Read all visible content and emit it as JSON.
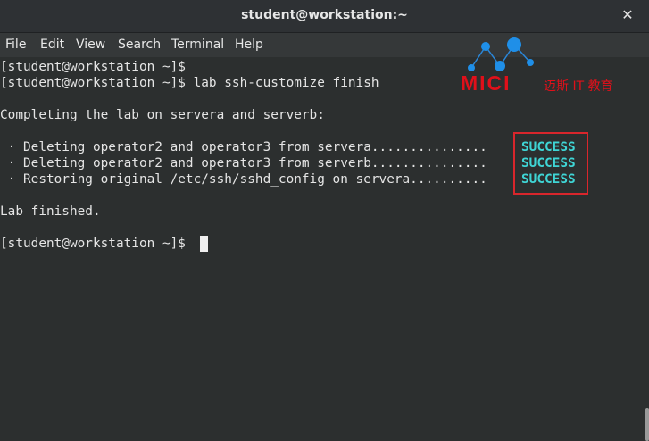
{
  "window": {
    "title": "student@workstation:~"
  },
  "menu": [
    "File",
    "Edit",
    "View",
    "Search",
    "Terminal",
    "Help"
  ],
  "terminal": {
    "lines": [
      "[student@workstation ~]$",
      "[student@workstation ~]$ lab ssh-customize finish",
      "",
      "Completing the lab on servera and serverb:",
      "",
      " · Deleting operator2 and operator3 from servera...............",
      " · Deleting operator2 and operator3 from serverb...............",
      " · Restoring original /etc/ssh/sshd_config on servera..........",
      "",
      "Lab finished.",
      "",
      "[student@workstation ~]$ "
    ],
    "status": [
      "SUCCESS",
      "SUCCESS",
      "SUCCESS"
    ]
  },
  "watermark": {
    "logo": "MICI",
    "text": "迈斯 IT 教育"
  },
  "colors": {
    "success": "#3fd5d5",
    "highlight_box": "#d9262c",
    "watermark": "#e0101a"
  }
}
